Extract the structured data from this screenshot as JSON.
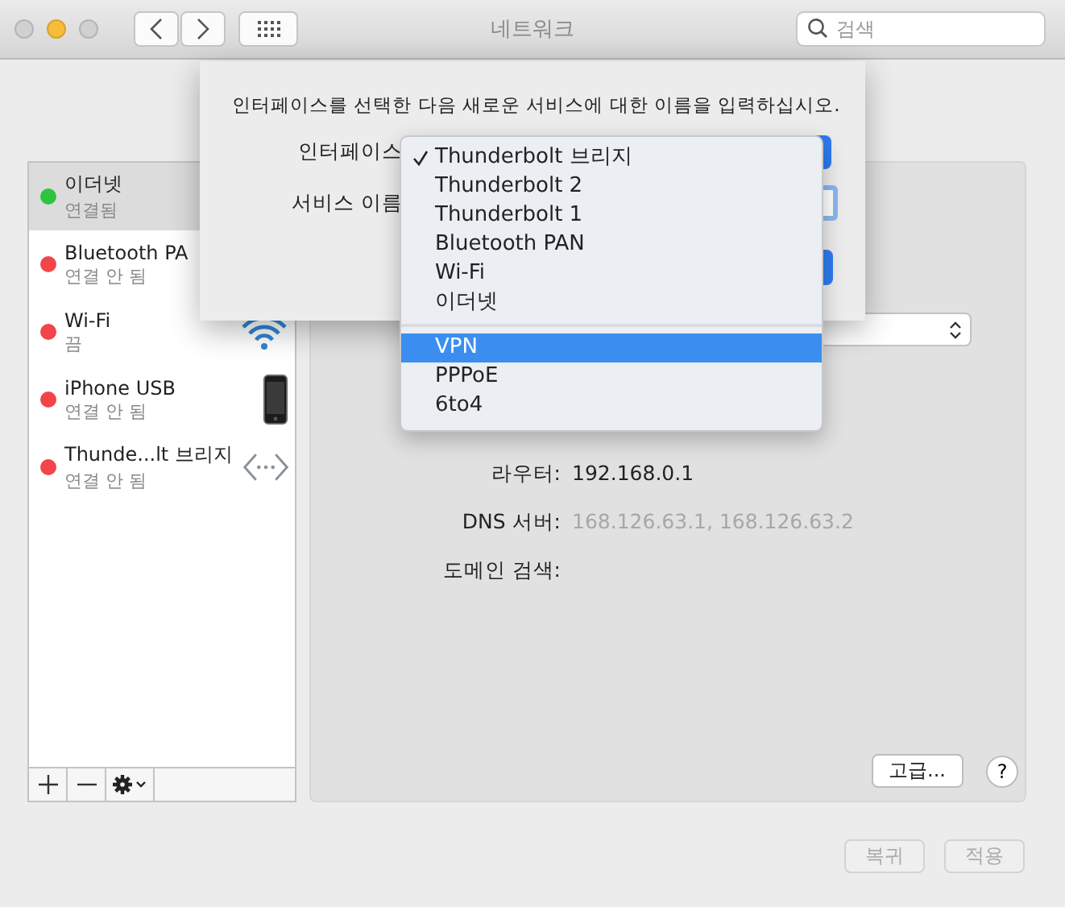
{
  "window": {
    "title": "네트워크",
    "search": {
      "placeholder": "검색"
    }
  },
  "services": [
    {
      "name": "이더넷",
      "status": "연결됨",
      "color": "#2ec440",
      "selected": true,
      "kind": "plain"
    },
    {
      "name": "Bluetooth PA",
      "status": "연결 안 됨",
      "color": "#f2444a",
      "selected": false,
      "kind": "plain"
    },
    {
      "name": "Wi-Fi",
      "status": "끔",
      "color": "#f2444a",
      "selected": false,
      "kind": "wifi"
    },
    {
      "name": "iPhone USB",
      "status": "연결 안 됨",
      "color": "#f2444a",
      "selected": false,
      "kind": "phone"
    },
    {
      "name": "Thunde...lt 브리지",
      "status": "연결 안 됨",
      "color": "#f2444a",
      "selected": false,
      "kind": "bridge"
    }
  ],
  "details": [
    {
      "label": "라우터:",
      "value": "192.168.0.1",
      "disabled": false
    },
    {
      "label": "DNS 서버:",
      "value": "168.126.63.1, 168.126.63.2",
      "disabled": true
    },
    {
      "label": "도메인 검색:"
    }
  ],
  "advanced_button": "고급...",
  "help_button": "?",
  "footer_buttons": [
    {
      "label": "복귀",
      "disabled": true
    },
    {
      "label": "적용",
      "disabled": true
    }
  ],
  "sheet": {
    "message": "인터페이스를 선택한 다음 새로운 서비스에 대한 이름을 입력하십시오.",
    "interface_label": "인터페이스",
    "service_name_label": "서비스 이름"
  },
  "interface_menu": [
    {
      "kind": "item",
      "label": "Thunderbolt 브리지",
      "checked": true,
      "selected": false
    },
    {
      "kind": "item",
      "label": "Thunderbolt 2",
      "checked": false,
      "selected": false
    },
    {
      "kind": "item",
      "label": "Thunderbolt 1",
      "checked": false,
      "selected": false
    },
    {
      "kind": "item",
      "label": "Bluetooth PAN",
      "checked": false,
      "selected": false
    },
    {
      "kind": "item",
      "label": "Wi-Fi",
      "checked": false,
      "selected": false
    },
    {
      "kind": "item",
      "label": "이더넷",
      "checked": false,
      "selected": false
    },
    {
      "kind": "separator"
    },
    {
      "kind": "item",
      "label": "VPN",
      "checked": false,
      "selected": true
    },
    {
      "kind": "item",
      "label": "PPPoE",
      "checked": false,
      "selected": false
    },
    {
      "kind": "item",
      "label": "6to4",
      "checked": false,
      "selected": false
    }
  ]
}
